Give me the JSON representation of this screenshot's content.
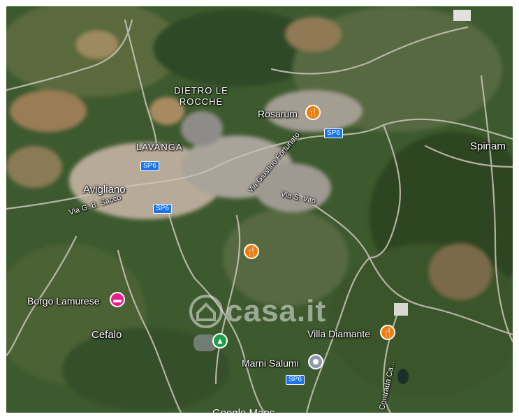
{
  "map": {
    "provider": "Google Maps",
    "watermark": "casa.it"
  },
  "places": {
    "dietro_le_rocche": "DIETRO LE\nROCCHE",
    "lavanga": "LAVANGA",
    "avigliano": "Avigliano",
    "cefalo": "Cefalo",
    "spinama": "Spinam"
  },
  "roads": {
    "via_sacco": "Via G. B. Sacco",
    "via_fortunato": "Via Giustino Fortunato",
    "via_s_vito": "Via S. Vito",
    "contrada": "Contrada Ca...",
    "sp6": "SP6"
  },
  "pois": {
    "rosarum": "Rosarum",
    "borgo_lamurese": "Borgo Lamurese",
    "villa_diamante": "Villa Diamante",
    "marni_salumi": "Marni Salumi"
  },
  "icons": {
    "restaurant": "fork-knife-icon",
    "hotel": "bed-icon",
    "park": "tree-icon",
    "generic": "dot-icon"
  },
  "colors": {
    "restaurant_pin": "#f57c00",
    "hotel_pin": "#e91e8c",
    "park_pin": "#1e9e4a",
    "road_shield": "#1a73e8"
  }
}
